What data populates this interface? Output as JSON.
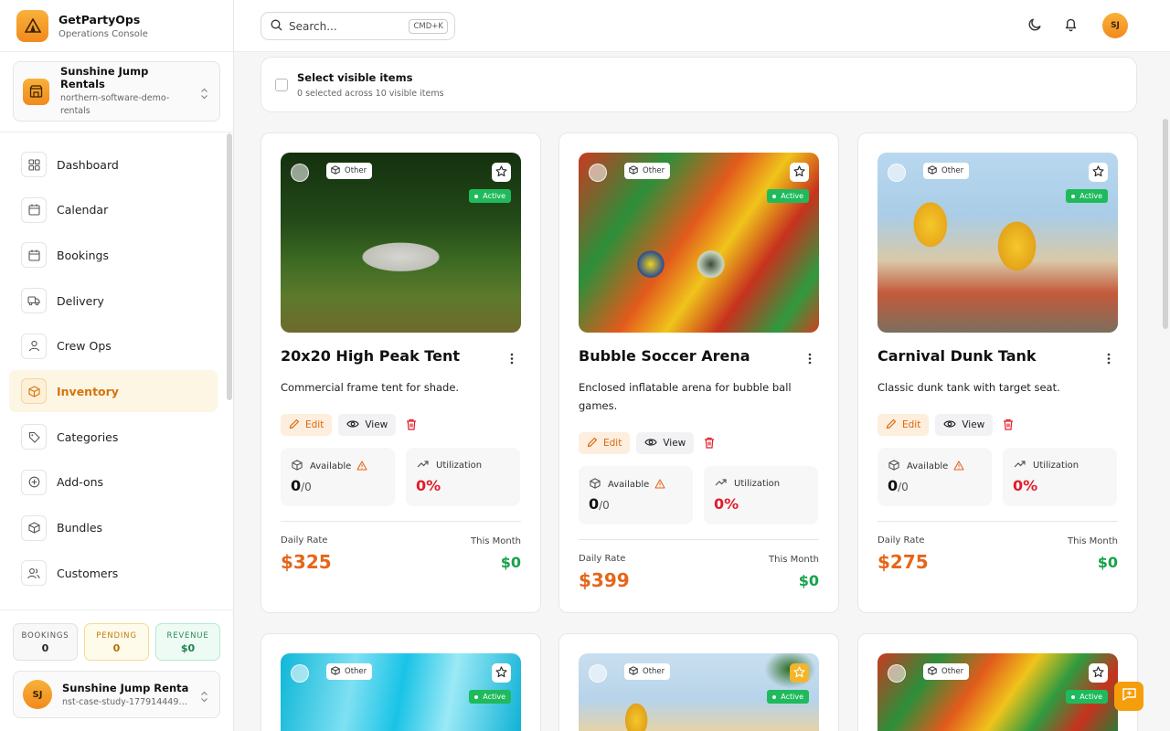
{
  "brand": {
    "name": "GetPartyOps",
    "subtitle": "Operations Console"
  },
  "org": {
    "name": "Sunshine Jump Rentals",
    "slug": "northern-software-demo-rentals"
  },
  "nav": [
    {
      "label": "Dashboard",
      "icon": "grid-icon"
    },
    {
      "label": "Calendar",
      "icon": "calendar-icon"
    },
    {
      "label": "Bookings",
      "icon": "calendar-check-icon"
    },
    {
      "label": "Delivery",
      "icon": "truck-icon"
    },
    {
      "label": "Crew Ops",
      "icon": "user-icon"
    },
    {
      "label": "Inventory",
      "icon": "box-icon",
      "active": true
    },
    {
      "label": "Categories",
      "icon": "tag-icon"
    },
    {
      "label": "Add-ons",
      "icon": "plus-circle-icon"
    },
    {
      "label": "Bundles",
      "icon": "package-icon"
    },
    {
      "label": "Customers",
      "icon": "users-icon"
    }
  ],
  "stats": {
    "bookings": {
      "label": "BOOKINGS",
      "value": "0"
    },
    "pending": {
      "label": "PENDING",
      "value": "0"
    },
    "revenue": {
      "label": "REVENUE",
      "value": "$0"
    }
  },
  "user": {
    "initials": "SJ",
    "name": "Sunshine Jump Rentals",
    "slug": "nst-case-study-1779144491..."
  },
  "topbar": {
    "search_placeholder": "Search...",
    "shortcut": "CMD+K",
    "avatar_initials": "SJ"
  },
  "selection": {
    "title": "Select visible items",
    "subtitle": "0 selected across 10 visible items"
  },
  "labels": {
    "edit": "Edit",
    "view": "View",
    "available": "Available",
    "utilization": "Utilization",
    "daily_rate": "Daily Rate",
    "this_month": "This Month",
    "category": "Other",
    "status": "Active"
  },
  "items": [
    {
      "title": "20x20 High Peak Tent",
      "description": "Commercial frame tent for shade.",
      "available": "0",
      "total": "/0",
      "utilization": "0%",
      "daily_rate": "$325",
      "month_revenue": "$0"
    },
    {
      "title": "Bubble Soccer Arena",
      "description": "Enclosed inflatable arena for bubble ball games.",
      "available": "0",
      "total": "/0",
      "utilization": "0%",
      "daily_rate": "$399",
      "month_revenue": "$0"
    },
    {
      "title": "Carnival Dunk Tank",
      "description": "Classic dunk tank with target seat.",
      "available": "0",
      "total": "/0",
      "utilization": "0%",
      "daily_rate": "$275",
      "month_revenue": "$0"
    }
  ],
  "colors": {
    "accent": "#f39a1e",
    "rate": "#e5661a",
    "revenue": "#16a34a",
    "active_badge": "#1fba5c",
    "danger": "#e11d2a"
  }
}
